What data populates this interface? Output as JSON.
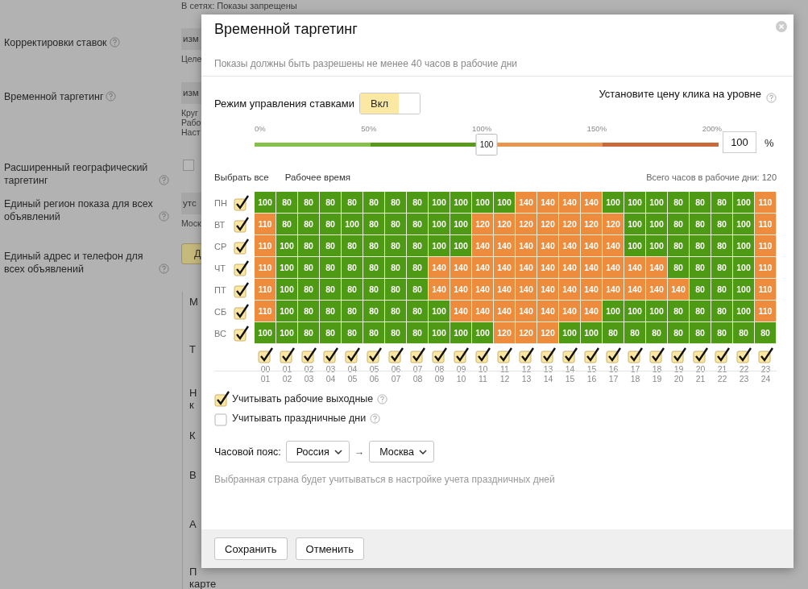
{
  "background_form": {
    "top_note": "В сетях: Показы запрещены",
    "rows": [
      {
        "label": "Корректировки ставок",
        "help": true,
        "kind": "field",
        "value": "изм",
        "notes": [
          "Целе"
        ]
      },
      {
        "label": "Временной таргетинг",
        "help": true,
        "kind": "field",
        "value": "изм",
        "notes": [
          "Круг",
          "Рабо",
          "Наст"
        ]
      },
      {
        "label": "Расширенный географический таргетинг",
        "help": true,
        "kind": "checkbox",
        "checked": false
      },
      {
        "label": "Единый регион показа для всех объявлений",
        "help": true,
        "kind": "field",
        "value": "утс",
        "notes": [
          "Моск"
        ]
      },
      {
        "label": "Единый адрес и телефон для всех объявлений",
        "help": true,
        "kind": "button",
        "value": "Д"
      }
    ],
    "panel_items": [
      {
        "lines": [
          "М"
        ]
      },
      {
        "lines": [
          "Т"
        ]
      },
      {
        "lines": [
          "Н",
          "к"
        ]
      },
      {
        "lines": [
          "К"
        ]
      },
      {
        "lines": [
          "В"
        ]
      },
      {
        "lines": [
          "А"
        ]
      },
      {
        "lines": [
          "П",
          "карте"
        ]
      }
    ]
  },
  "modal": {
    "title": "Временной таргетинг",
    "subtitle": "Показы должны быть разрешены не менее 40 часов в рабочие дни",
    "bid_mode": {
      "label": "Режим управления ставками",
      "toggle_label": "Вкл",
      "on": true
    },
    "price_label": "Установите цену клика на уровне",
    "slider": {
      "ticks": [
        "0%",
        "50%",
        "100%",
        "150%",
        "200%"
      ],
      "level": 0.5,
      "thumb_label": "100"
    },
    "price_input": "100",
    "unit": "%",
    "links": [
      "Выбрать все",
      "Рабочее время"
    ],
    "total_hours": "Всего часов в рабочие дни: 120",
    "days": [
      {
        "label": "ПН",
        "checked": true,
        "cells": [
          "100",
          "80",
          "80",
          "80",
          "80",
          "80",
          "80",
          "80",
          "100",
          "100",
          "100",
          "100",
          "140",
          "140",
          "140",
          "140",
          "100",
          "100",
          "100",
          "80",
          "80",
          "80",
          "100",
          "110"
        ]
      },
      {
        "label": "ВТ",
        "checked": true,
        "cells": [
          "110",
          "80",
          "80",
          "80",
          "100",
          "80",
          "80",
          "80",
          "100",
          "100",
          "120",
          "120",
          "120",
          "120",
          "120",
          "120",
          "120",
          "100",
          "100",
          "80",
          "80",
          "80",
          "100",
          "110"
        ]
      },
      {
        "label": "СР",
        "checked": true,
        "cells": [
          "110",
          "100",
          "80",
          "80",
          "80",
          "80",
          "80",
          "80",
          "100",
          "100",
          "140",
          "140",
          "140",
          "140",
          "140",
          "140",
          "140",
          "100",
          "100",
          "80",
          "80",
          "80",
          "100",
          "110"
        ]
      },
      {
        "label": "ЧТ",
        "checked": true,
        "cells": [
          "110",
          "100",
          "80",
          "80",
          "80",
          "80",
          "80",
          "80",
          "140",
          "140",
          "140",
          "140",
          "140",
          "140",
          "140",
          "140",
          "140",
          "140",
          "140",
          "80",
          "80",
          "80",
          "100",
          "110"
        ]
      },
      {
        "label": "ПТ",
        "checked": true,
        "cells": [
          "110",
          "100",
          "80",
          "80",
          "80",
          "80",
          "80",
          "80",
          "140",
          "140",
          "140",
          "140",
          "140",
          "140",
          "140",
          "140",
          "140",
          "140",
          "140",
          "140",
          "80",
          "80",
          "100",
          "110"
        ]
      },
      {
        "label": "СБ",
        "checked": true,
        "cells": [
          "110",
          "100",
          "80",
          "80",
          "80",
          "80",
          "80",
          "80",
          "100",
          "140",
          "140",
          "140",
          "140",
          "140",
          "140",
          "140",
          "100",
          "100",
          "100",
          "80",
          "80",
          "80",
          "100",
          "110"
        ]
      },
      {
        "label": "ВС",
        "checked": true,
        "cells": [
          "100",
          "100",
          "80",
          "80",
          "80",
          "80",
          "80",
          "80",
          "100",
          "100",
          "100",
          "120",
          "120",
          "120",
          "100",
          "100",
          "80",
          "80",
          "80",
          "80",
          "80",
          "80",
          "80",
          "80"
        ]
      }
    ],
    "hours": [
      {
        "from": "00",
        "to": "01",
        "checked": true
      },
      {
        "from": "01",
        "to": "02",
        "checked": true
      },
      {
        "from": "02",
        "to": "03",
        "checked": true
      },
      {
        "from": "03",
        "to": "04",
        "checked": true
      },
      {
        "from": "04",
        "to": "05",
        "checked": true
      },
      {
        "from": "05",
        "to": "06",
        "checked": true
      },
      {
        "from": "06",
        "to": "07",
        "checked": true
      },
      {
        "from": "07",
        "to": "08",
        "checked": true
      },
      {
        "from": "08",
        "to": "09",
        "checked": true
      },
      {
        "from": "09",
        "to": "10",
        "checked": true
      },
      {
        "from": "10",
        "to": "11",
        "checked": true
      },
      {
        "from": "11",
        "to": "12",
        "checked": true
      },
      {
        "from": "12",
        "to": "13",
        "checked": true
      },
      {
        "from": "13",
        "to": "14",
        "checked": true
      },
      {
        "from": "14",
        "to": "15",
        "checked": true
      },
      {
        "from": "15",
        "to": "16",
        "checked": true
      },
      {
        "from": "16",
        "to": "17",
        "checked": true
      },
      {
        "from": "17",
        "to": "18",
        "checked": true
      },
      {
        "from": "18",
        "to": "19",
        "checked": true
      },
      {
        "from": "19",
        "to": "20",
        "checked": true
      },
      {
        "from": "20",
        "to": "21",
        "checked": true
      },
      {
        "from": "21",
        "to": "22",
        "checked": true
      },
      {
        "from": "22",
        "to": "23",
        "checked": true
      },
      {
        "from": "23",
        "to": "24",
        "checked": true
      }
    ],
    "options": [
      {
        "label": "Учитывать рабочие выходные",
        "checked": true
      },
      {
        "label": "Учитывать праздничные дни",
        "checked": false
      }
    ],
    "timezone": {
      "label": "Часовой пояс:",
      "country": "Россия",
      "arrow": "→",
      "city": "Москва"
    },
    "hint": "Выбранная страна будет учитываться в настройке учета праздничных дней",
    "buttons": [
      "Сохранить",
      "Отменить"
    ]
  }
}
